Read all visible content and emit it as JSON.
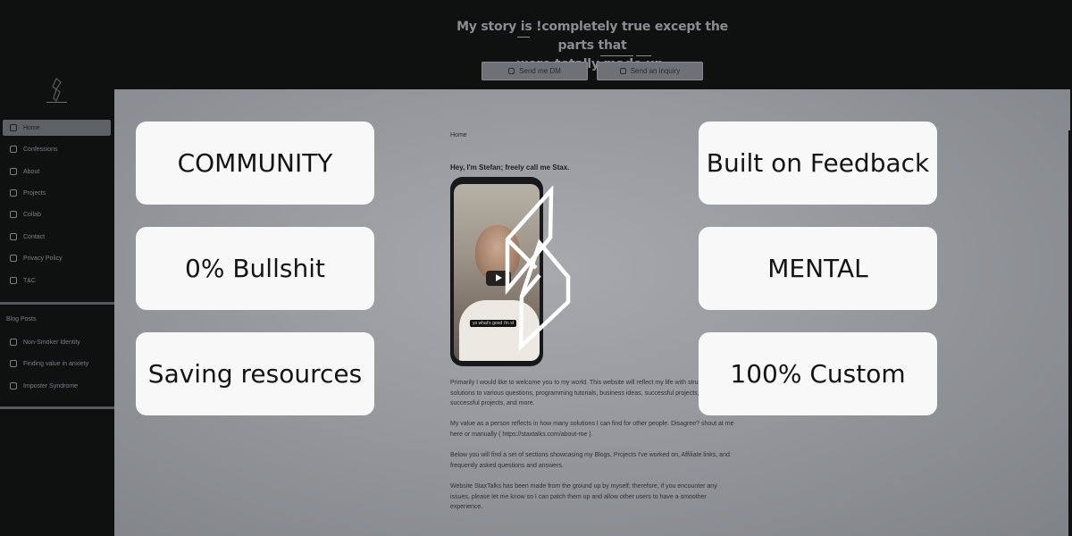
{
  "header": {
    "headline_line1": "My story is !completely true except the parts that",
    "headline_line2": "were totally made up.",
    "dm_button": "Send me DM",
    "inquiry_button": "Send an inquiry"
  },
  "sidebar": {
    "items": [
      {
        "label": "Home",
        "icon": "home-icon",
        "active": true
      },
      {
        "label": "Confessions",
        "icon": "mic-icon"
      },
      {
        "label": "About",
        "icon": "user-icon"
      },
      {
        "label": "Projects",
        "icon": "folder-icon"
      },
      {
        "label": "Collab",
        "icon": "collab-icon"
      },
      {
        "label": "Contact",
        "icon": "chat-icon"
      },
      {
        "label": "Privacy Policy",
        "icon": "shield-icon"
      },
      {
        "label": "T&C",
        "icon": "shield-icon"
      }
    ],
    "blog_title": "Blog Posts",
    "blog_posts": [
      {
        "label": "Non-Smoker Identity",
        "icon": "external-link-icon"
      },
      {
        "label": "Finding value in anxiety",
        "icon": "external-link-icon"
      },
      {
        "label": "Imposter Syndrome",
        "icon": "external-link-icon"
      }
    ]
  },
  "main": {
    "breadcrumb": "Home",
    "greeting": "Hey, I'm Stefan; freely call me Stax.",
    "video_caption": "yo what's good i'm st",
    "paragraphs": [
      "Primarily I would like to welcome you to my world. This website will reflect my life with struggles, solutions to various questions, programming tutorials, business ideas, successful projects, less successful projects, and more.",
      "My value as a person reflects in how many solutions I can find for other people. Disagree? shout at me here or manually ( https://staxtalks.com/about-me ).",
      "Below you will find a set of sections showcasing my Blogs, Projects I've worked on, Affiliate links, and frequently asked questions and answers.",
      "Website StaxTalks has been made from the ground up by myself; therefore, if you encounter any issues, please let me know so I can patch them up and allow other users to have a smoother experience."
    ]
  },
  "cards": {
    "left": [
      "COMMUNITY",
      "0% Bullshit",
      "Saving resources"
    ],
    "right": [
      "Built on Feedback",
      "MENTAL",
      "100% Custom"
    ]
  },
  "colors": {
    "card_bg": "#f8f8f8",
    "page_bg": "#0f1111",
    "content_bg": "#9a9ca0"
  }
}
